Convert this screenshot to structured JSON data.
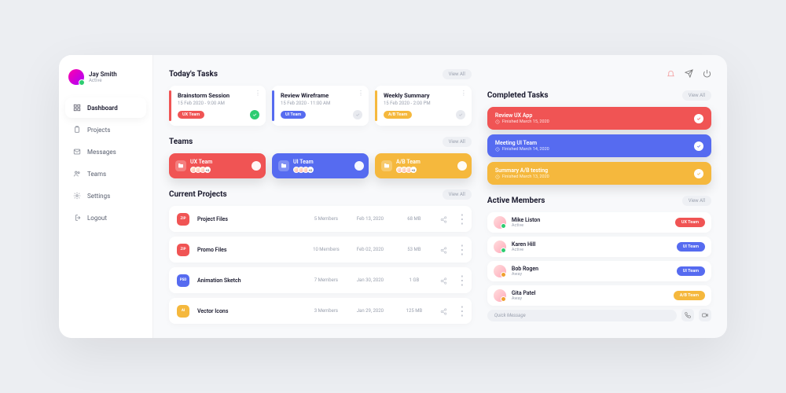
{
  "user": {
    "name": "Jay Smith",
    "status": "Active"
  },
  "nav": [
    {
      "label": "Dashboard"
    },
    {
      "label": "Projects"
    },
    {
      "label": "Messages"
    },
    {
      "label": "Teams"
    },
    {
      "label": "Settings"
    },
    {
      "label": "Logout"
    }
  ],
  "sections": {
    "tasks": "Today's Tasks",
    "teams": "Teams",
    "projects": "Current Projects",
    "completed": "Completed Tasks",
    "members": "Active Members"
  },
  "view_all": "View All",
  "tasks": [
    {
      "title": "Brainstorm Session",
      "date": "15 Feb 2020 - 9:00 AM",
      "team": "UX Team",
      "done": true
    },
    {
      "title": "Review Wireframe",
      "date": "15 Feb 2020 - 11:00 AM",
      "team": "UI Team",
      "done": false
    },
    {
      "title": "Weekly Summary",
      "date": "15 Feb 2020 - 2:00 PM",
      "team": "A/B Team",
      "done": false
    }
  ],
  "teams": [
    {
      "name": "UX Team"
    },
    {
      "name": "UI Team"
    },
    {
      "name": "A/B Team"
    }
  ],
  "projects": [
    {
      "ext": "ZIP",
      "name": "Project Files",
      "members": "5 Members",
      "date": "Feb 13, 2020",
      "size": "68 MB",
      "color": "red"
    },
    {
      "ext": "ZIP",
      "name": "Promo Files",
      "members": "10 Members",
      "date": "Feb 02, 2020",
      "size": "53 MB",
      "color": "red"
    },
    {
      "ext": "PSD",
      "name": "Animation Sketch",
      "members": "7 Members",
      "date": "Jan 30, 2020",
      "size": "1 GB",
      "color": "blue"
    },
    {
      "ext": "AI",
      "name": "Vector Icons",
      "members": "3 Members",
      "date": "Jan 29, 2020",
      "size": "125 MB",
      "color": "yellow"
    }
  ],
  "completed": [
    {
      "title": "Review UX App",
      "date": "Finished March 15, 2020"
    },
    {
      "title": "Meeting UI Team",
      "date": "Finished March 14, 2020"
    },
    {
      "title": "Summary A/B testing",
      "date": "Finished March 13, 2020"
    }
  ],
  "members": [
    {
      "name": "Mike Liston",
      "status": "Active",
      "team": "UX Team",
      "color": "red",
      "on": true
    },
    {
      "name": "Karen Hill",
      "status": "Active",
      "team": "UI Team",
      "color": "blue",
      "on": true
    },
    {
      "name": "Bob Rogen",
      "status": "Away",
      "team": "UI Team",
      "color": "blue",
      "on": false
    },
    {
      "name": "Gita Patel",
      "status": "Away",
      "team": "A/B Team",
      "color": "yellow",
      "on": false
    }
  ],
  "quick_message": "Quick Message",
  "more": "+2"
}
